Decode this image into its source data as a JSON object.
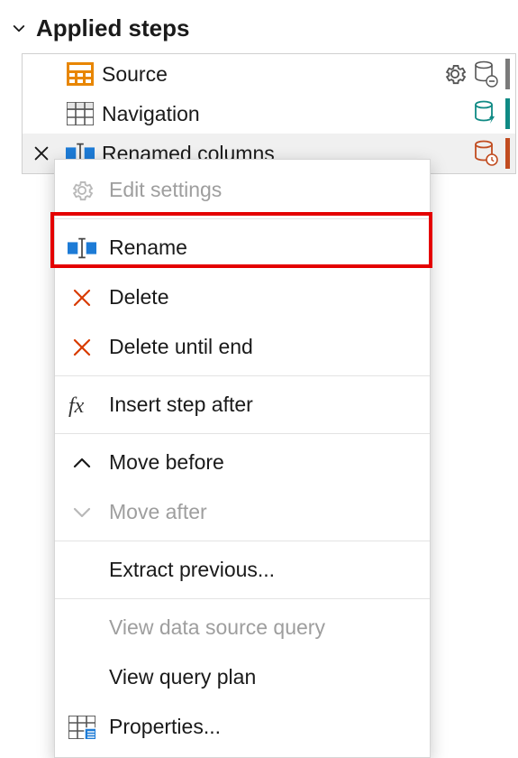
{
  "header": {
    "title": "Applied steps"
  },
  "steps": [
    {
      "label": "Source",
      "bar_color": "#7a7a7a"
    },
    {
      "label": "Navigation",
      "bar_color": "#0f8a84"
    },
    {
      "label": "Renamed columns",
      "bar_color": "#c14c20"
    }
  ],
  "menu": {
    "edit_settings": "Edit settings",
    "rename": "Rename",
    "delete": "Delete",
    "delete_until_end": "Delete until end",
    "insert_step_after": "Insert step after",
    "move_before": "Move before",
    "move_after": "Move after",
    "extract_previous": "Extract previous...",
    "view_data_source_query": "View data source query",
    "view_query_plan": "View query plan",
    "properties": "Properties..."
  }
}
